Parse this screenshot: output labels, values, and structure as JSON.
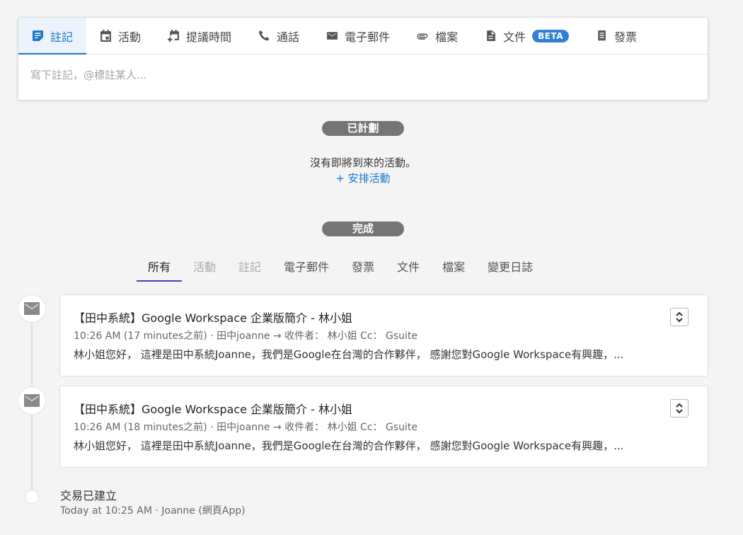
{
  "composer": {
    "tabs": [
      {
        "label": "註記",
        "icon": "note-icon"
      },
      {
        "label": "活動",
        "icon": "calendar-icon"
      },
      {
        "label": "提議時間",
        "icon": "calendar-add-icon"
      },
      {
        "label": "通話",
        "icon": "phone-icon"
      },
      {
        "label": "電子郵件",
        "icon": "mail-icon"
      },
      {
        "label": "檔案",
        "icon": "paperclip-icon"
      },
      {
        "label": "文件",
        "icon": "document-icon",
        "badge": "BETA"
      },
      {
        "label": "發票",
        "icon": "invoice-icon"
      }
    ],
    "placeholder": "寫下註記，@標註某人..."
  },
  "planned": {
    "label": "已計劃",
    "empty_message": "沒有即將到來的活動。",
    "schedule_link": "+ 安排活動"
  },
  "done": {
    "label": "完成",
    "filters": [
      "所有",
      "活動",
      "註記",
      "電子郵件",
      "發票",
      "文件",
      "檔案",
      "變更日誌"
    ]
  },
  "emails": [
    {
      "subject": "【田中系統】Google Workspace 企業版簡介 - 林小姐",
      "meta": "10:26 AM (17 minutes之前) · 田中joanne → 收件者： 林小姐 Cc： Gsuite",
      "preview": "林小姐您好， 這裡是田中系統Joanne，我們是Google在台灣的合作夥伴， 感謝您對Google Workspace有興趣，..."
    },
    {
      "subject": "【田中系統】Google Workspace 企業版簡介 - 林小姐",
      "meta": "10:26 AM (18 minutes之前) · 田中joanne → 收件者： 林小姐 Cc： Gsuite",
      "preview": "林小姐您好， 這裡是田中系統Joanne，我們是Google在台灣的合作夥伴， 感謝您對Google Workspace有興趣，..."
    }
  ],
  "deal_event": {
    "title": "交易已建立",
    "meta": "Today at 10:25 AM  · Joanne (網頁App)"
  },
  "colors": {
    "accent": "#1a73c8",
    "badge": "#2f80d6",
    "pill": "#757575",
    "active_filter_underline": "#5b3aa8"
  }
}
